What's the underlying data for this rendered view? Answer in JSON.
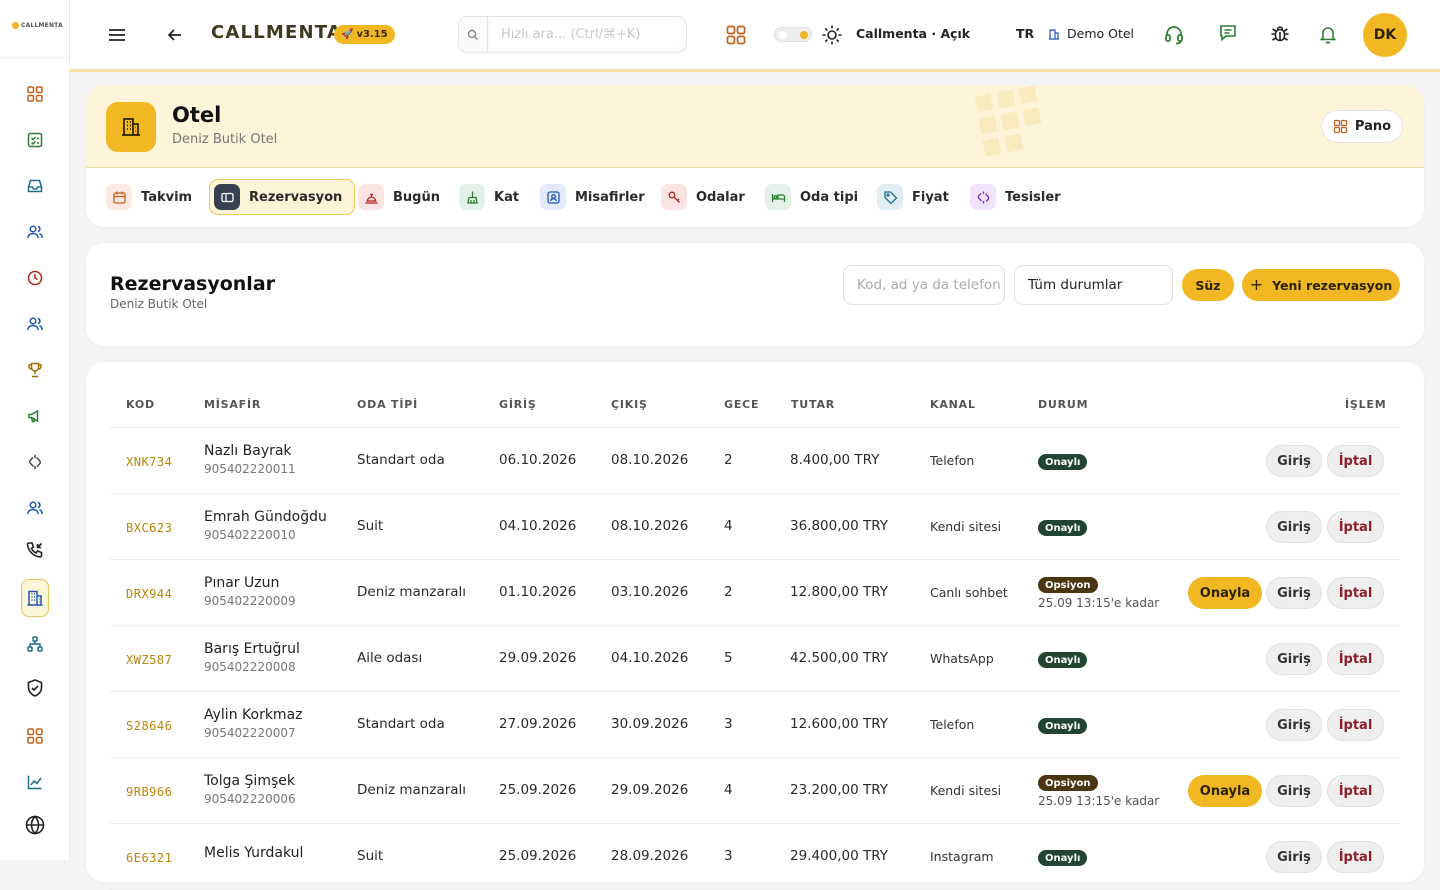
{
  "sidebar": {
    "logo": "CALLMENTA"
  },
  "topbar": {
    "brand": "CALLMENTA",
    "version": "v3.15",
    "search_placeholder": "Hızlı ara... (Ctrl/⌘+K)",
    "workspace": "Callmenta · Açık",
    "lang": "TR",
    "hotel": "Demo Otel",
    "avatar": "DK"
  },
  "hero": {
    "title": "Otel",
    "subtitle": "Deniz Butik Otel",
    "pano": "Pano"
  },
  "tabs": [
    {
      "label": "Takvim"
    },
    {
      "label": "Rezervasyon"
    },
    {
      "label": "Bugün"
    },
    {
      "label": "Kat"
    },
    {
      "label": "Misafirler"
    },
    {
      "label": "Odalar"
    },
    {
      "label": "Oda tipi"
    },
    {
      "label": "Fiyat"
    },
    {
      "label": "Tesisler"
    }
  ],
  "list": {
    "title": "Rezervasyonlar",
    "subtitle": "Deniz Butik Otel",
    "search_placeholder": "Kod, ad ya da telefon",
    "status_filter": "Tüm durumlar",
    "filter_button": "Süz",
    "new_button": "Yeni rezervasyon"
  },
  "table": {
    "headers": [
      "KOD",
      "MİSAFİR",
      "ODA TİPİ",
      "GİRİŞ",
      "ÇIKIŞ",
      "GECE",
      "TUTAR",
      "KANAL",
      "DURUM",
      "İŞLEM"
    ],
    "actions": {
      "confirm": "Onayla",
      "checkin": "Giriş",
      "cancel": "İptal"
    },
    "rows": [
      {
        "code": "XNK734",
        "name": "Nazlı Bayrak",
        "phone": "905402220011",
        "room": "Standart oda",
        "in": "06.10.2026",
        "out": "08.10.2026",
        "nights": "2",
        "total": "8.400,00 TRY",
        "channel": "Telefon",
        "status": "Onaylı",
        "until": ""
      },
      {
        "code": "BXC623",
        "name": "Emrah Gündoğdu",
        "phone": "905402220010",
        "room": "Suit",
        "in": "04.10.2026",
        "out": "08.10.2026",
        "nights": "4",
        "total": "36.800,00 TRY",
        "channel": "Kendi sitesi",
        "status": "Onaylı",
        "until": ""
      },
      {
        "code": "DRX944",
        "name": "Pınar Uzun",
        "phone": "905402220009",
        "room": "Deniz manzaralı",
        "in": "01.10.2026",
        "out": "03.10.2026",
        "nights": "2",
        "total": "12.800,00 TRY",
        "channel": "Canlı sohbet",
        "status": "Opsiyon",
        "until": "25.09 13:15'e kadar"
      },
      {
        "code": "XWZ587",
        "name": "Barış Ertuğrul",
        "phone": "905402220008",
        "room": "Aile odası",
        "in": "29.09.2026",
        "out": "04.10.2026",
        "nights": "5",
        "total": "42.500,00 TRY",
        "channel": "WhatsApp",
        "status": "Onaylı",
        "until": ""
      },
      {
        "code": "S28646",
        "name": "Aylin Korkmaz",
        "phone": "905402220007",
        "room": "Standart oda",
        "in": "27.09.2026",
        "out": "30.09.2026",
        "nights": "3",
        "total": "12.600,00 TRY",
        "channel": "Telefon",
        "status": "Onaylı",
        "until": ""
      },
      {
        "code": "9RB966",
        "name": "Tolga Şimşek",
        "phone": "905402220006",
        "room": "Deniz manzaralı",
        "in": "25.09.2026",
        "out": "29.09.2026",
        "nights": "4",
        "total": "23.200,00 TRY",
        "channel": "Kendi sitesi",
        "status": "Opsiyon",
        "until": "25.09 13:15'e kadar"
      },
      {
        "code": "6E6321",
        "name": "Melis Yurdakul",
        "phone": "",
        "room": "Suit",
        "in": "25.09.2026",
        "out": "28.09.2026",
        "nights": "3",
        "total": "29.400,00 TRY",
        "channel": "Instagram",
        "status": "Onaylı",
        "until": ""
      }
    ]
  }
}
